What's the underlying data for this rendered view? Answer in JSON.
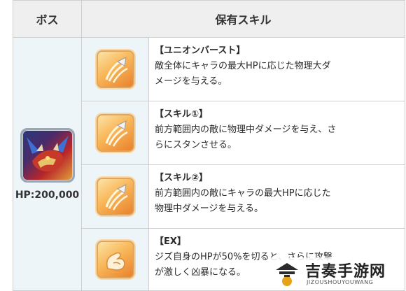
{
  "headers": {
    "boss": "ボス",
    "skills": "保有スキル"
  },
  "boss": {
    "hp": "HP:200,000",
    "portrait_icon": "dragon-boss-portrait-icon"
  },
  "skills": [
    {
      "name": "【ユニオンバースト】",
      "desc1": "敵全体にキャラの最大HPに応じた物理大ダ",
      "desc2": "メージを与える。",
      "icon": "claw-slash-icon"
    },
    {
      "name": "【スキル①】",
      "desc1": "前方範囲内の敵に物理中ダメージを与え、さ",
      "desc2": "らにスタンさせる。",
      "icon": "claw-slash-icon"
    },
    {
      "name": "【スキル②】",
      "desc1": "前方範囲内の敵にキャラの最大HPに応じた",
      "desc2": "物理中ダメージを与える。",
      "icon": "claw-slash-icon"
    },
    {
      "name": "【EX】",
      "desc1": "ジズ自身のHPが50%を切ると、さらに攻撃",
      "desc2": "が激しく凶暴になる。",
      "icon": "flexed-arm-icon"
    }
  ],
  "watermark": {
    "title": "吉奏手游网",
    "subtitle": "JIZOUSHOUYOUWANG"
  }
}
